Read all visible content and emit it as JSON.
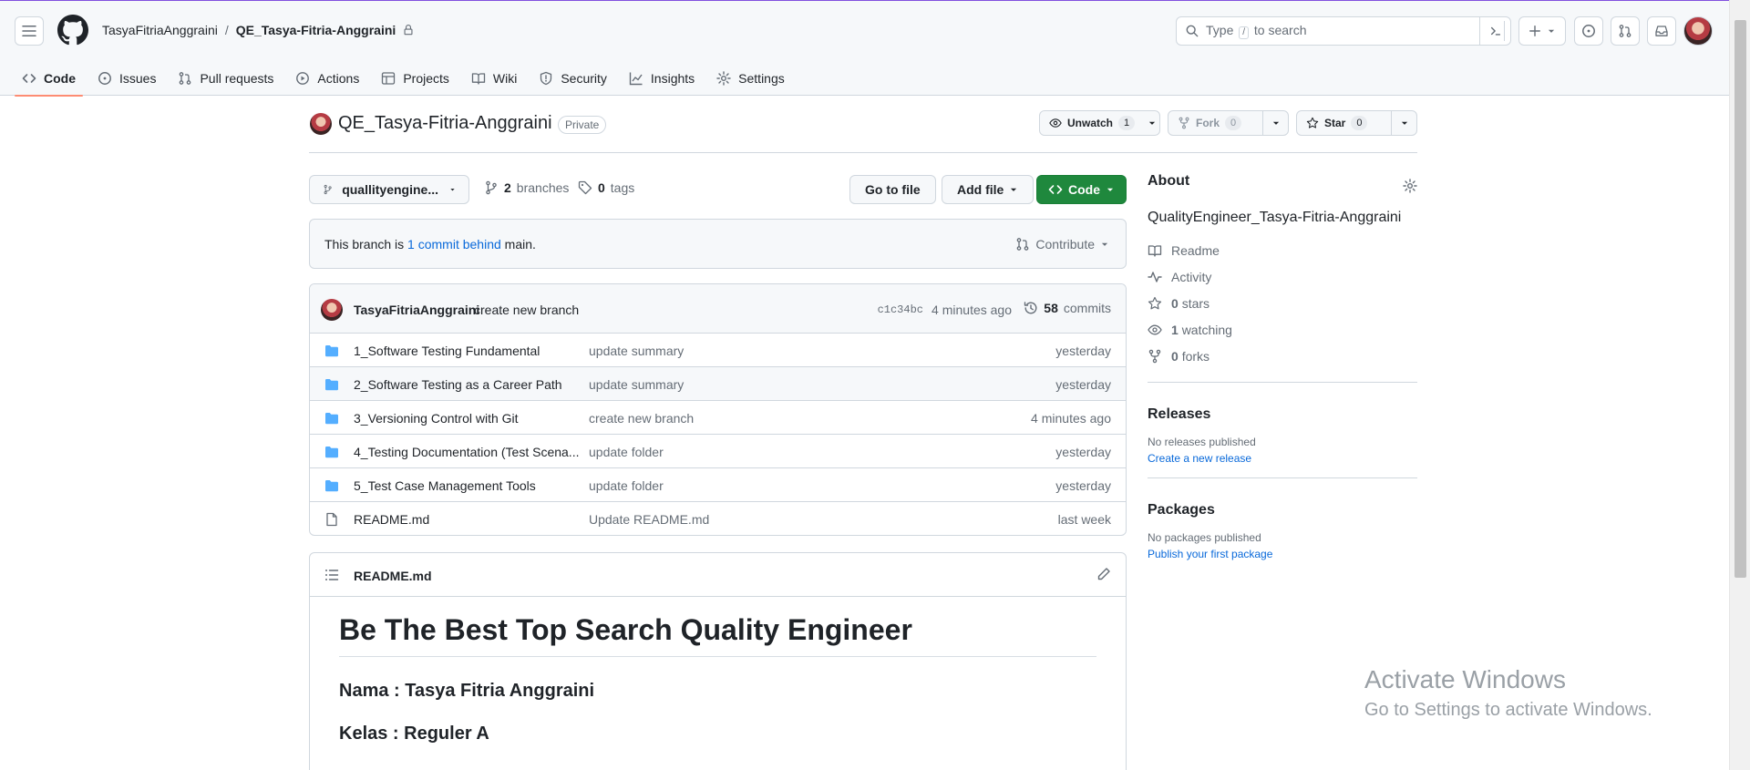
{
  "header": {
    "owner": "TasyaFitriaAnggraini",
    "separator": "/",
    "repo": "QE_Tasya-Fitria-Anggraini",
    "search_prefix": "Type",
    "search_key": "/",
    "search_suffix": "to search"
  },
  "tabs": [
    {
      "label": "Code",
      "icon": "code-icon"
    },
    {
      "label": "Issues",
      "icon": "issue-icon"
    },
    {
      "label": "Pull requests",
      "icon": "pull-request-icon"
    },
    {
      "label": "Actions",
      "icon": "play-icon"
    },
    {
      "label": "Projects",
      "icon": "table-icon"
    },
    {
      "label": "Wiki",
      "icon": "book-icon"
    },
    {
      "label": "Security",
      "icon": "shield-icon"
    },
    {
      "label": "Insights",
      "icon": "graph-icon"
    },
    {
      "label": "Settings",
      "icon": "gear-icon"
    }
  ],
  "repo_header": {
    "name": "QE_Tasya-Fitria-Anggraini",
    "visibility": "Private",
    "unwatch_label": "Unwatch",
    "unwatch_count": "1",
    "fork_label": "Fork",
    "fork_count": "0",
    "star_label": "Star",
    "star_count": "0"
  },
  "file_nav": {
    "branch": "quallityengine...",
    "branches_count": "2",
    "branches_label": "branches",
    "tags_count": "0",
    "tags_label": "tags",
    "go_to_file": "Go to file",
    "add_file": "Add file",
    "code": "Code"
  },
  "banner": {
    "prefix": "This branch is",
    "link": "1 commit behind",
    "suffix": "main.",
    "contribute": "Contribute"
  },
  "latest_commit": {
    "author": "TasyaFitriaAnggraini",
    "message": "create new branch",
    "sha": "c1c34bc",
    "time": "4 minutes ago",
    "commits_count": "58",
    "commits_label": "commits"
  },
  "files": [
    {
      "name": "1_Software Testing Fundamental",
      "message": "update summary",
      "date": "yesterday",
      "type": "folder"
    },
    {
      "name": "2_Software Testing as a Career Path",
      "message": "update summary",
      "date": "yesterday",
      "type": "folder"
    },
    {
      "name": "3_Versioning Control with Git",
      "message": "create new branch",
      "date": "4 minutes ago",
      "type": "folder"
    },
    {
      "name": "4_Testing Documentation (Test Scena...",
      "message": "update folder",
      "date": "yesterday",
      "type": "folder"
    },
    {
      "name": "5_Test Case Management Tools",
      "message": "update folder",
      "date": "yesterday",
      "type": "folder"
    },
    {
      "name": "README.md",
      "message": "Update README.md",
      "date": "last week",
      "type": "file"
    }
  ],
  "readme": {
    "title": "README.md",
    "h1": "Be The Best Top Search Quality Engineer",
    "line1": "Nama : Tasya Fitria Anggraini",
    "line2": "Kelas : Reguler A"
  },
  "about": {
    "heading": "About",
    "description": "QualityEngineer_Tasya-Fitria-Anggraini",
    "readme": "Readme",
    "activity": "Activity",
    "stars_count": "0",
    "stars_label": "stars",
    "watching_count": "1",
    "watching_label": "watching",
    "forks_count": "0",
    "forks_label": "forks"
  },
  "releases": {
    "heading": "Releases",
    "empty": "No releases published",
    "link": "Create a new release"
  },
  "packages": {
    "heading": "Packages",
    "empty": "No packages published",
    "link": "Publish your first package"
  },
  "watermark": {
    "line1": "Activate Windows",
    "line2": "Go to Settings to activate Windows."
  },
  "colors": {
    "accent_tab": "#fd8c73",
    "primary_button": "#1f883d",
    "link": "#0969da",
    "folder": "#54aeff"
  }
}
